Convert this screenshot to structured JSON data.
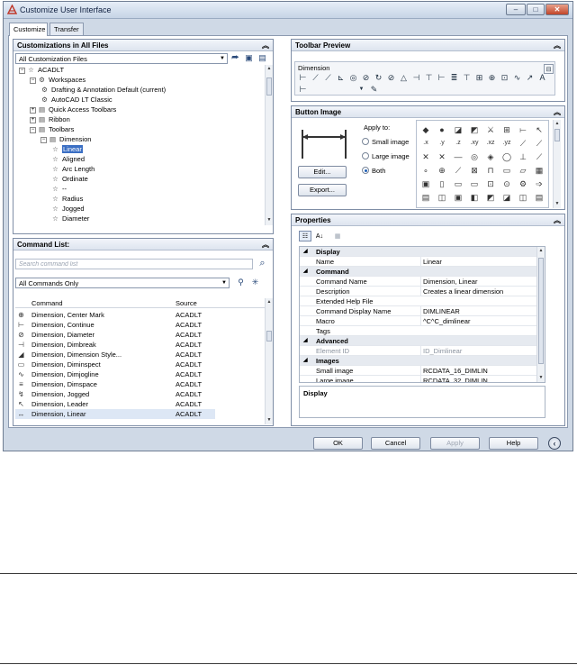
{
  "window": {
    "title": "Customize User Interface",
    "controls": {
      "minimize": "–",
      "maximize": "□",
      "close": "✕"
    }
  },
  "tabs": [
    {
      "label": "Customize"
    },
    {
      "label": "Transfer"
    }
  ],
  "customizations": {
    "header": "Customizations in All Files",
    "filter_value": "All Customization Files",
    "tree": [
      {
        "label": "ACADLT",
        "icon": "star",
        "exp": "−",
        "level": 0
      },
      {
        "label": "Workspaces",
        "icon": "gear",
        "exp": "−",
        "level": 1
      },
      {
        "label": "Drafting & Annotation Default (current)",
        "icon": "gear",
        "exp": "",
        "level": 2
      },
      {
        "label": "AutoCAD LT Classic",
        "icon": "gear",
        "exp": "",
        "level": 2
      },
      {
        "label": "Quick Access Toolbars",
        "icon": "toolbar",
        "exp": "+",
        "level": 1
      },
      {
        "label": "Ribbon",
        "icon": "toolbar",
        "exp": "+",
        "level": 1
      },
      {
        "label": "Toolbars",
        "icon": "toolbar",
        "exp": "−",
        "level": 1
      },
      {
        "label": "Dimension",
        "icon": "toolbar",
        "exp": "−",
        "level": 2
      },
      {
        "label": "Linear",
        "icon": "star",
        "exp": "",
        "level": 3,
        "selected": true
      },
      {
        "label": "Aligned",
        "icon": "star",
        "exp": "",
        "level": 3
      },
      {
        "label": "Arc Length",
        "icon": "star",
        "exp": "",
        "level": 3
      },
      {
        "label": "Ordinate",
        "icon": "star",
        "exp": "",
        "level": 3
      },
      {
        "label": "--",
        "icon": "star",
        "exp": "",
        "level": 3
      },
      {
        "label": "Radius",
        "icon": "star",
        "exp": "",
        "level": 3
      },
      {
        "label": "Jogged",
        "icon": "star",
        "exp": "",
        "level": 3
      },
      {
        "label": "Diameter",
        "icon": "star",
        "exp": "",
        "level": 3
      }
    ]
  },
  "command_list": {
    "header": "Command List:",
    "search_placeholder": "Search command list",
    "filter_value": "All Commands Only",
    "columns": {
      "command": "Command",
      "source": "Source"
    },
    "rows": [
      {
        "name": "Dimension, Center Mark",
        "source": "ACADLT",
        "icon": "⊕"
      },
      {
        "name": "Dimension, Continue",
        "source": "ACADLT",
        "icon": "⊢"
      },
      {
        "name": "Dimension, Diameter",
        "source": "ACADLT",
        "icon": "⊘"
      },
      {
        "name": "Dimension, Dimbreak",
        "source": "ACADLT",
        "icon": "⊣"
      },
      {
        "name": "Dimension, Dimension Style...",
        "source": "ACADLT",
        "icon": "◢"
      },
      {
        "name": "Dimension, Diminspect",
        "source": "ACADLT",
        "icon": "▭"
      },
      {
        "name": "Dimension, Dimjogline",
        "source": "ACADLT",
        "icon": "∿"
      },
      {
        "name": "Dimension, Dimspace",
        "source": "ACADLT",
        "icon": "≡"
      },
      {
        "name": "Dimension, Jogged",
        "source": "ACADLT",
        "icon": "↯"
      },
      {
        "name": "Dimension, Leader",
        "source": "ACADLT",
        "icon": "↖"
      },
      {
        "name": "Dimension, Linear",
        "source": "ACADLT",
        "icon": "↔",
        "selected": true
      }
    ]
  },
  "toolbar_preview": {
    "header": "Toolbar Preview",
    "toolbar_name": "Dimension"
  },
  "button_image": {
    "header": "Button Image",
    "apply_to": "Apply to:",
    "options": [
      {
        "label": "Small image",
        "checked": false
      },
      {
        "label": "Large image",
        "checked": false
      },
      {
        "label": "Both",
        "checked": true
      }
    ],
    "edit_label": "Edit...",
    "export_label": "Export...",
    "grid_labels": [
      ".x",
      ".y",
      ".z",
      ".xy",
      ".xz",
      ".yz"
    ]
  },
  "properties": {
    "header": "Properties",
    "rows": [
      {
        "type": "cat",
        "key": "Display",
        "value": ""
      },
      {
        "type": "prop",
        "key": "Name",
        "value": "Linear"
      },
      {
        "type": "cat",
        "key": "Command",
        "value": ""
      },
      {
        "type": "prop",
        "key": "Command Name",
        "value": "Dimension, Linear"
      },
      {
        "type": "prop",
        "key": "Description",
        "value": "Creates a linear dimension"
      },
      {
        "type": "prop",
        "key": "Extended Help File",
        "value": ""
      },
      {
        "type": "prop",
        "key": "Command Display Name",
        "value": "DIMLINEAR"
      },
      {
        "type": "prop",
        "key": "Macro",
        "value": "^C^C_dimlinear"
      },
      {
        "type": "prop",
        "key": "Tags",
        "value": ""
      },
      {
        "type": "cat",
        "key": "Advanced",
        "value": ""
      },
      {
        "type": "grey",
        "key": "Element ID",
        "value": "ID_Dimlinear"
      },
      {
        "type": "cat",
        "key": "Images",
        "value": ""
      },
      {
        "type": "prop",
        "key": "Small image",
        "value": "RCDATA_16_DIMLIN"
      },
      {
        "type": "prop",
        "key": "Large image",
        "value": "RCDATA_32_DIMLIN"
      }
    ],
    "description_title": "Display"
  },
  "footer": {
    "ok": "OK",
    "cancel": "Cancel",
    "apply": "Apply",
    "help": "Help"
  }
}
